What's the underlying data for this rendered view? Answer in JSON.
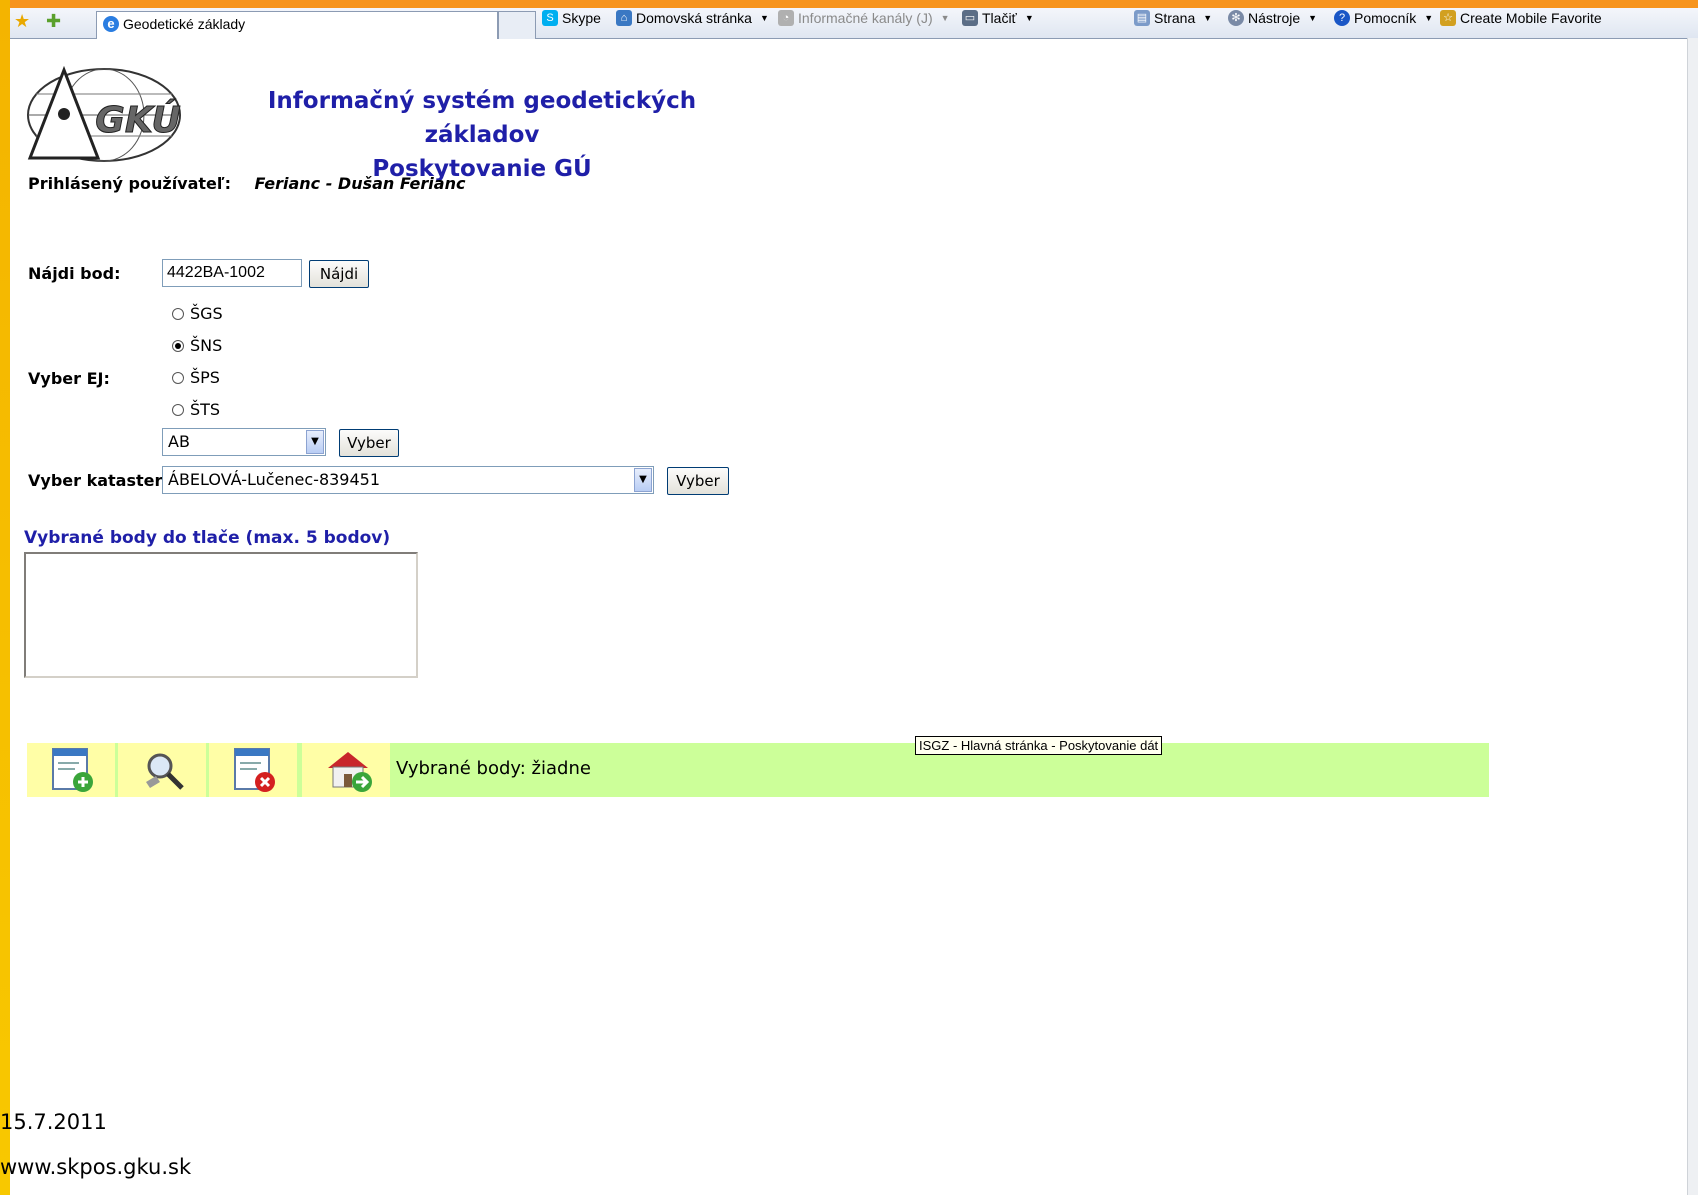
{
  "browser": {
    "tab_title": "Geodetické základy",
    "commands": [
      {
        "label": "Skype",
        "icon": "skype-icon",
        "color": "#00aff0",
        "dropdown": false,
        "disabled": false
      },
      {
        "label": "Domovská stránka",
        "icon": "home-icon",
        "color": "#3a78c3",
        "dropdown": true,
        "disabled": false
      },
      {
        "label": "Informačné kanály (J)",
        "icon": "rss-icon",
        "color": "#b0b0b0",
        "dropdown": true,
        "disabled": true
      },
      {
        "label": "Tlačiť",
        "icon": "printer-icon",
        "color": "#5b6d86",
        "dropdown": true,
        "disabled": false
      },
      {
        "label": "Strana",
        "icon": "page-icon",
        "color": "#7c9bc9",
        "dropdown": true,
        "disabled": false
      },
      {
        "label": "Nástroje",
        "icon": "gear-icon",
        "color": "#7a8aa6",
        "dropdown": true,
        "disabled": false
      },
      {
        "label": "Pomocník",
        "icon": "help-icon",
        "color": "#1a56c6",
        "dropdown": true,
        "disabled": false
      },
      {
        "label": "Create Mobile Favorite",
        "icon": "mobile-favorite-icon",
        "color": "#d2a020",
        "dropdown": false,
        "disabled": false
      }
    ]
  },
  "header": {
    "logo_text": "GKÚ",
    "title_line1": "Informačný systém geodetických základov",
    "title_line2": "Poskytovanie GÚ",
    "title_color": "#1f1fa8"
  },
  "user": {
    "label": "Prihlásený používateľ:",
    "value": "Ferianc - Dušan Ferianc"
  },
  "find_point": {
    "label": "Nájdi bod:",
    "value": "4422BA-1002",
    "button": "Nájdi"
  },
  "ej": {
    "label": "Vyber EJ:",
    "options": [
      {
        "label": "ŠGS",
        "checked": false
      },
      {
        "label": "ŠNS",
        "checked": true
      },
      {
        "label": "ŠPS",
        "checked": false
      },
      {
        "label": "ŠTS",
        "checked": false
      }
    ],
    "select_value": "AB",
    "button": "Vyber"
  },
  "cadastre": {
    "label": "Vyber kataster:",
    "select_value": "ÁBELOVÁ-Lučenec-839451",
    "button": "Vyber"
  },
  "selected_points": {
    "title": "Vybrané body do tlače (max. 5 bodov)"
  },
  "toolbar": {
    "status": "Vybrané body: žiadne",
    "tooltip": "ISGZ - Hlavná stránka - Poskytovanie dát",
    "bar_color": "#ccff99",
    "cell_color": "#fffea6"
  },
  "footer": {
    "date": "15.7.2011",
    "url": "www.skpos.gku.sk"
  }
}
